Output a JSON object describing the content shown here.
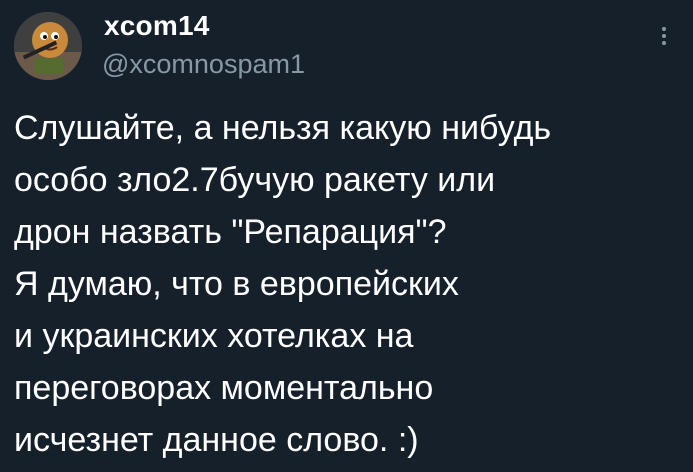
{
  "author": {
    "display_name": "xcom14",
    "handle": "@xcomnospam1",
    "avatar_icon": "cartoon-character-avatar-icon"
  },
  "more_icon": "more-vertical-icon",
  "tweet": {
    "lines": [
      "Слушайте, а нельзя какую нибудь",
      "особо зло2.7бучую ракету или",
      "дрон назвать \"Репарация\"?",
      "Я думаю, что в европейских",
      "и украинских хотелках на",
      "переговорах моментально",
      "исчезнет данное слово. :)"
    ]
  },
  "colors": {
    "background": "#15202b",
    "text": "#ffffff",
    "secondary_text": "#8899a6"
  }
}
